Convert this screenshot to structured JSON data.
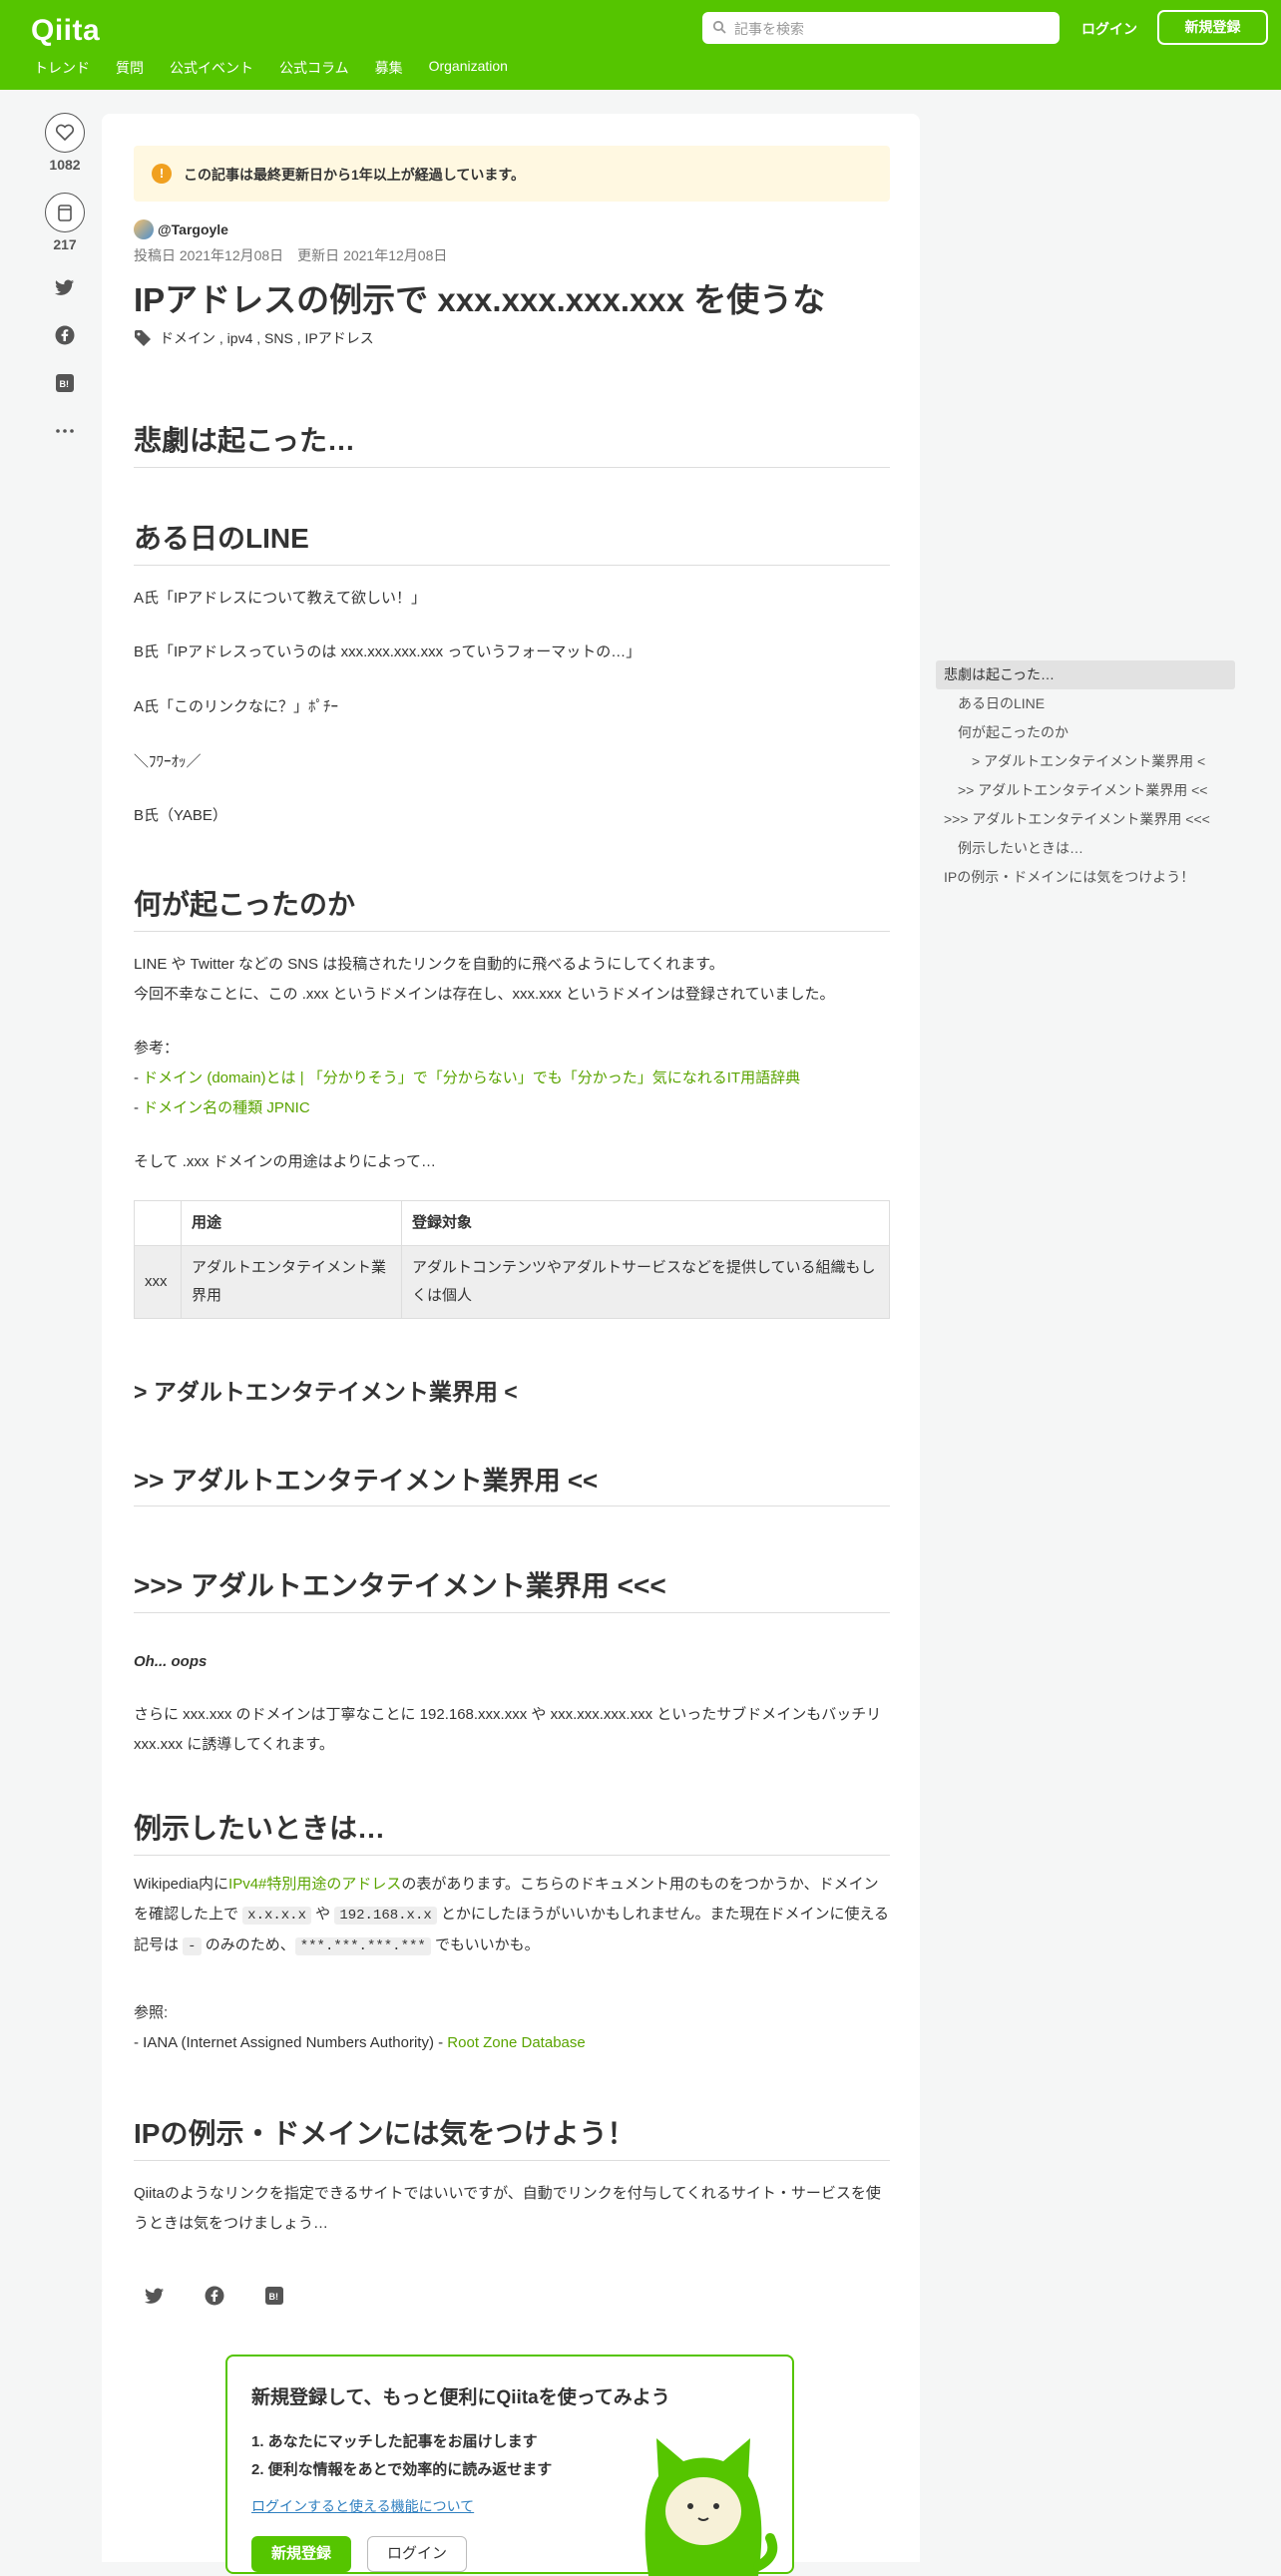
{
  "header": {
    "logo": "Qiita",
    "search_placeholder": "記事を検索",
    "login": "ログイン",
    "signup": "新規登録",
    "nav": [
      "トレンド",
      "質問",
      "公式イベント",
      "公式コラム",
      "募集",
      "Organization"
    ]
  },
  "side": {
    "likes": "1082",
    "stocks": "217"
  },
  "article": {
    "notice": "この記事は最終更新日から1年以上が経過しています。",
    "author": "@Targoyle",
    "dates": "投稿日 2021年12月08日　更新日 2021年12月08日",
    "title": "IPアドレスの例示で xxx.xxx.xxx.xxx を使うな",
    "tags": "ドメイン , ipv4 , SNS , IPアドレス",
    "h_tragedy": "悲劇は起こった…",
    "h_line": "ある日のLINE",
    "line1": "A氏「IPアドレスについて教えて欲しい！」",
    "line2": "B氏「IPアドレスっていうのは xxx.xxx.xxx.xxx っていうフォーマットの…」",
    "line3": "A氏「このリンクなに？」ﾎﾟﾁｰ",
    "line4": "＼ﾌﾜｰｵｯ／",
    "line5": "B氏（YABE）",
    "h_what": "何が起こったのか",
    "what1": "LINE や Twitter などの SNS は投稿されたリンクを自動的に飛べるようにしてくれます。",
    "what2": "今回不幸なことに、この .xxx というドメインは存在し、xxx.xxx というドメインは登録されていました。",
    "ref_label": "参考：",
    "ref1": "ドメイン (domain)とは | 「分かりそう」で「分からない」でも「分かった」気になれるIT用語辞典",
    "ref2": "ドメイン名の種類 JPNIC",
    "and_then": "そして .xxx ドメインの用途はよりによって…",
    "table": {
      "headers": [
        "",
        "用途",
        "登録対象"
      ],
      "row": [
        "xxx",
        "アダルトエンタテイメント業界用",
        "アダルトコンテンツやアダルトサービスなどを提供している組織もしくは個人"
      ]
    },
    "h_adult1": "> アダルトエンタテイメント業界用 <",
    "h_adult2": ">> アダルトエンタテイメント業界用 <<",
    "h_adult3": ">>> アダルトエンタテイメント業界用 <<<",
    "oops": "Oh... oops",
    "sub1": "さらに xxx.xxx のドメインは丁寧なことに 192.168.xxx.xxx や xxx.xxx.xxx.xxx といったサブドメインもバッチリ xxx.xxx に誘導してくれます。",
    "h_example": "例示したいときは…",
    "ex_pre": "Wikipedia内に",
    "ex_link": "IPv4#特別用途のアドレス",
    "ex_post": "の表があります。こちらのドキュメント用のものをつかうか、ドメインを確認した上で ",
    "code1": "x.x.x.x",
    "ex_mid": " や ",
    "code2": "192.168.x.x",
    "ex_tail": " とかにしたほうがいいかもしれません。また現在ドメインに使える記号は ",
    "code3": "-",
    "ex_tail2": " のみのため、",
    "code4": "***.***.***.***",
    "ex_end": " でもいいかも。",
    "ref2_label": "参照:",
    "iana": "- IANA (Internet Assigned Numbers Authority) - ",
    "iana_link": "Root Zone Database",
    "h_careful": "IPの例示・ドメインには気をつけよう！",
    "careful": "Qiitaのようなリンクを指定できるサイトではいいですが、自動でリンクを付与してくれるサイト・サービスを使うときは気をつけましょう…"
  },
  "promo": {
    "heading": "新規登録して、もっと便利にQiitaを使ってみよう",
    "item1": "1. あなたにマッチした記事をお届けします",
    "item2": "2. 便利な情報をあとで効率的に読み返せます",
    "link": "ログインすると使える機能について",
    "signup": "新規登録",
    "login": "ログイン"
  },
  "toc": [
    "悲劇は起こった…",
    "ある日のLINE",
    "何が起こったのか",
    "> アダルトエンタテイメント業界用 <",
    ">> アダルトエンタテイメント業界用 <<",
    ">>> アダルトエンタテイメント業界用 <<<",
    "例示したいときは…",
    "IPの例示・ドメインには気をつけよう！"
  ],
  "colors": {
    "brand": "#55c500",
    "link": "#5aa400"
  }
}
